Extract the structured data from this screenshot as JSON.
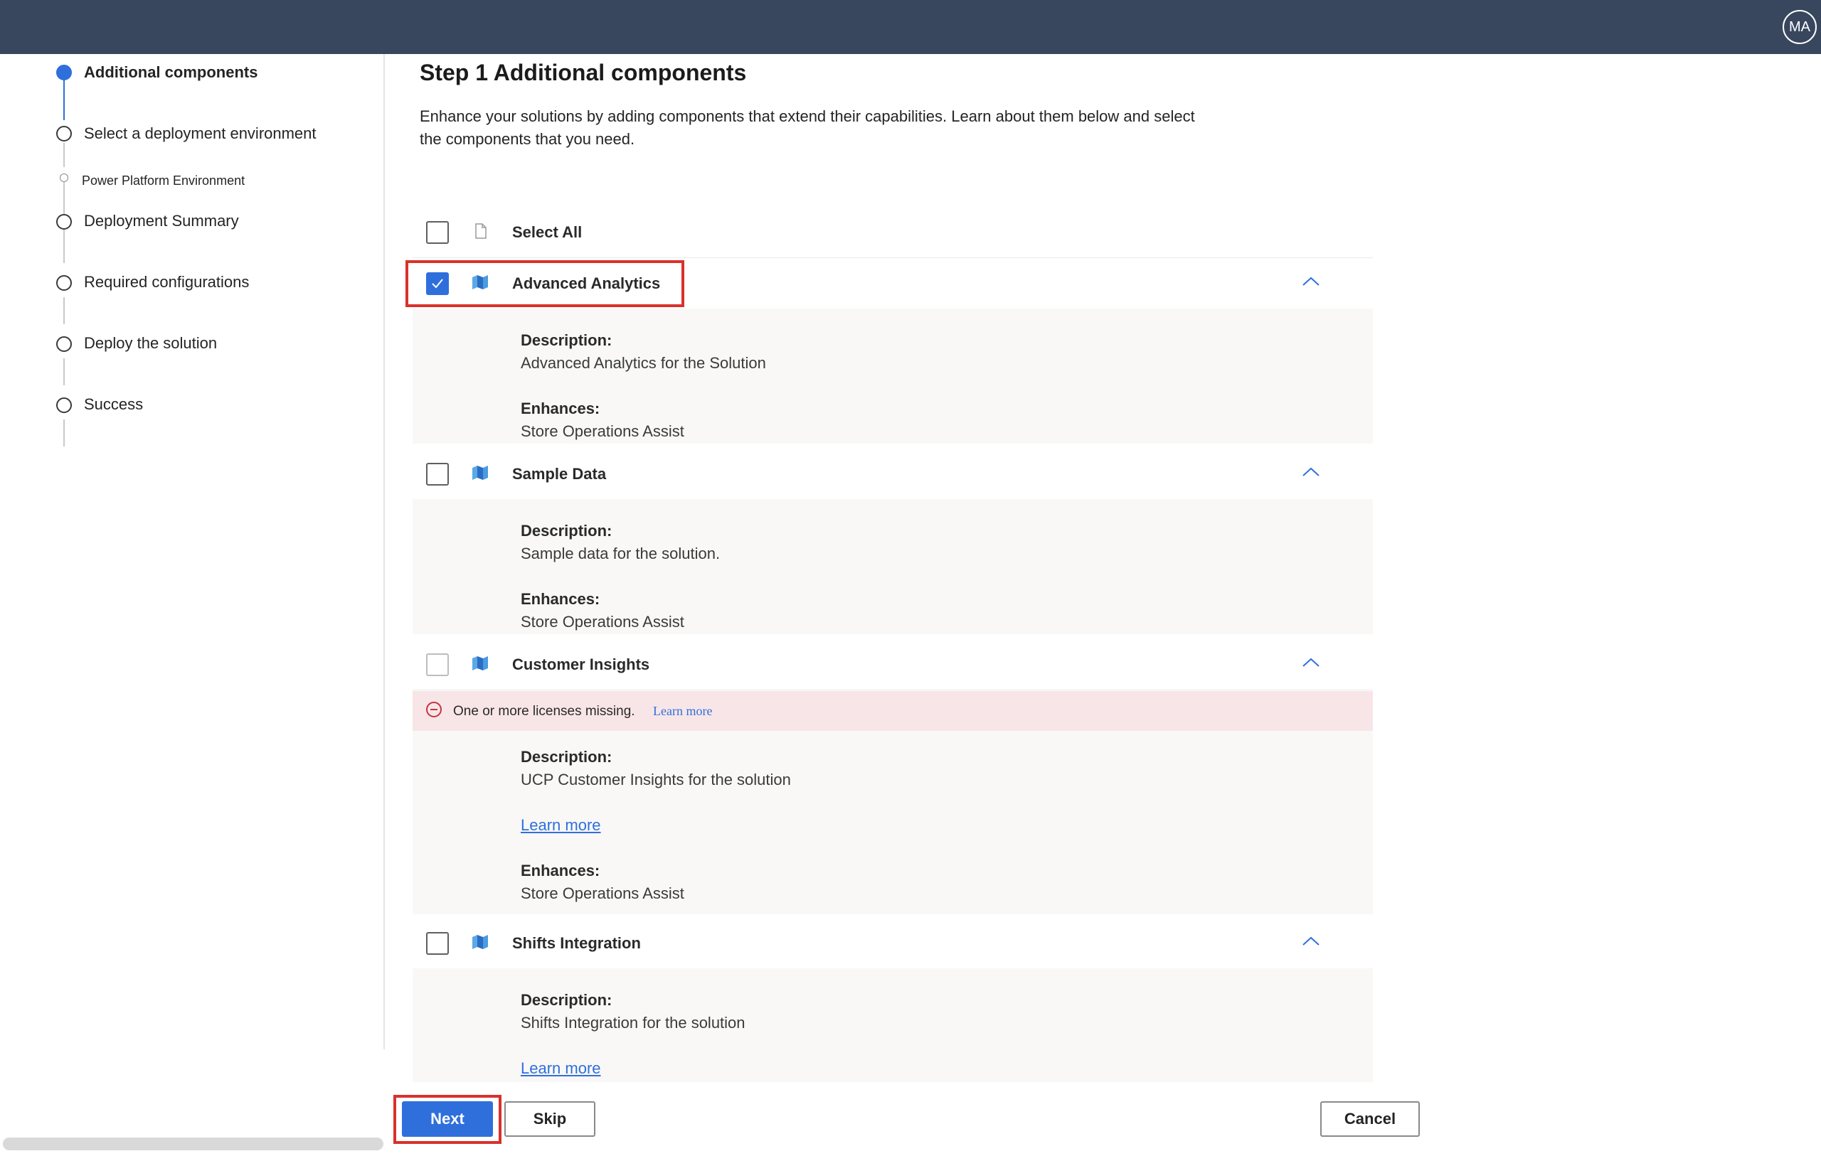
{
  "header": {
    "avatar_initials": "MA"
  },
  "stepper": {
    "steps": [
      {
        "label": "Additional components",
        "state": "current"
      },
      {
        "label": "Select a deployment environment",
        "state": "pending"
      },
      {
        "label": "Power Platform Environment",
        "state": "substep"
      },
      {
        "label": "Deployment Summary",
        "state": "pending"
      },
      {
        "label": "Required configurations",
        "state": "pending"
      },
      {
        "label": "Deploy the solution",
        "state": "pending"
      },
      {
        "label": "Success",
        "state": "pending"
      }
    ]
  },
  "main": {
    "title": "Step 1 Additional components",
    "description": "Enhance your solutions by adding components that extend their capabilities. Learn about them below and select the components that you need.",
    "select_all": "Select All",
    "components": [
      {
        "name": "Advanced Analytics",
        "checked": true,
        "description_label": "Description:",
        "description": "Advanced Analytics for the Solution",
        "enhances_label": "Enhances:",
        "enhances": "Store Operations Assist"
      },
      {
        "name": "Sample Data",
        "checked": false,
        "description_label": "Description:",
        "description": "Sample data for the solution.",
        "enhances_label": "Enhances:",
        "enhances": "Store Operations Assist"
      },
      {
        "name": "Customer Insights",
        "checked": false,
        "disabled": true,
        "warning": "One or more licenses missing.",
        "warning_link": "Learn more",
        "description_label": "Description:",
        "description": "UCP Customer Insights for the solution",
        "learn_more": "Learn more",
        "enhances_label": "Enhances:",
        "enhances": "Store Operations Assist"
      },
      {
        "name": "Shifts Integration",
        "checked": false,
        "description_label": "Description:",
        "description": "Shifts Integration for the solution",
        "learn_more": "Learn more"
      }
    ]
  },
  "footer": {
    "next_label": "Next",
    "skip_label": "Skip",
    "cancel_label": "Cancel"
  },
  "colors": {
    "topbar": "#38475e",
    "accent": "#2f6fdc",
    "highlight": "#d9312b",
    "warning_bg": "#f8e5e7"
  }
}
